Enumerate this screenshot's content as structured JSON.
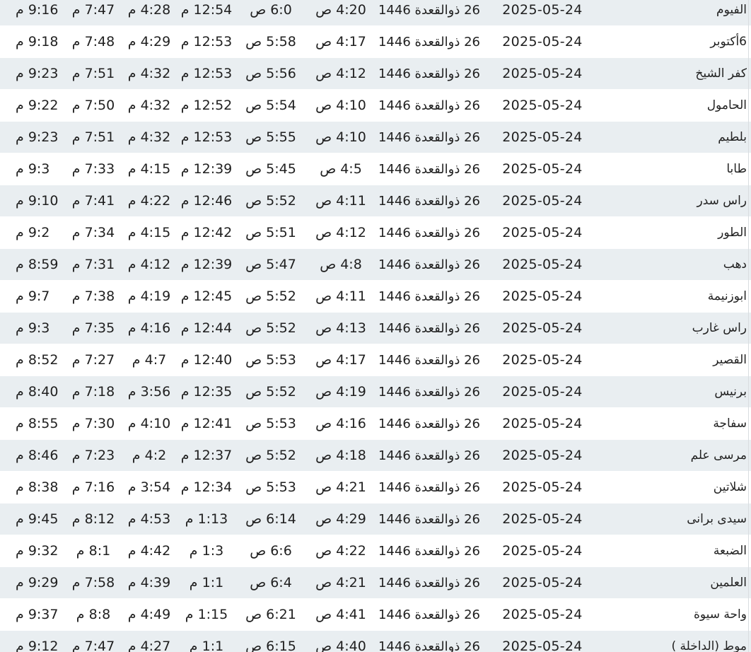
{
  "table": {
    "rows": [
      {
        "city": "الفيوم",
        "gregorian": "2025-05-24",
        "hijri": "26 ذوالقعدة 1446",
        "fajr": "4:20 ص",
        "sunrise": "6:0 ص",
        "dhuhr": "12:54 م",
        "asr": "4:28 م",
        "maghrib": "7:47 م",
        "isha": "9:16 م"
      },
      {
        "city": "6أكتوبر",
        "gregorian": "2025-05-24",
        "hijri": "26 ذوالقعدة 1446",
        "fajr": "4:17 ص",
        "sunrise": "5:58 ص",
        "dhuhr": "12:53 م",
        "asr": "4:29 م",
        "maghrib": "7:48 م",
        "isha": "9:18 م"
      },
      {
        "city": "كفر الشيخ",
        "gregorian": "2025-05-24",
        "hijri": "26 ذوالقعدة 1446",
        "fajr": "4:12 ص",
        "sunrise": "5:56 ص",
        "dhuhr": "12:53 م",
        "asr": "4:32 م",
        "maghrib": "7:51 م",
        "isha": "9:23 م"
      },
      {
        "city": "الحامول",
        "gregorian": "2025-05-24",
        "hijri": "26 ذوالقعدة 1446",
        "fajr": "4:10 ص",
        "sunrise": "5:54 ص",
        "dhuhr": "12:52 م",
        "asr": "4:32 م",
        "maghrib": "7:50 م",
        "isha": "9:22 م"
      },
      {
        "city": "بلطيم",
        "gregorian": "2025-05-24",
        "hijri": "26 ذوالقعدة 1446",
        "fajr": "4:10 ص",
        "sunrise": "5:55 ص",
        "dhuhr": "12:53 م",
        "asr": "4:32 م",
        "maghrib": "7:51 م",
        "isha": "9:23 م"
      },
      {
        "city": "طابا",
        "gregorian": "2025-05-24",
        "hijri": "26 ذوالقعدة 1446",
        "fajr": "4:5 ص",
        "sunrise": "5:45 ص",
        "dhuhr": "12:39 م",
        "asr": "4:15 م",
        "maghrib": "7:33 م",
        "isha": "9:3 م"
      },
      {
        "city": "راس سدر",
        "gregorian": "2025-05-24",
        "hijri": "26 ذوالقعدة 1446",
        "fajr": "4:11 ص",
        "sunrise": "5:52 ص",
        "dhuhr": "12:46 م",
        "asr": "4:22 م",
        "maghrib": "7:41 م",
        "isha": "9:10 م"
      },
      {
        "city": "الطور",
        "gregorian": "2025-05-24",
        "hijri": "26 ذوالقعدة 1446",
        "fajr": "4:12 ص",
        "sunrise": "5:51 ص",
        "dhuhr": "12:42 م",
        "asr": "4:15 م",
        "maghrib": "7:34 م",
        "isha": "9:2 م"
      },
      {
        "city": "دهب",
        "gregorian": "2025-05-24",
        "hijri": "26 ذوالقعدة 1446",
        "fajr": "4:8 ص",
        "sunrise": "5:47 ص",
        "dhuhr": "12:39 م",
        "asr": "4:12 م",
        "maghrib": "7:31 م",
        "isha": "8:59 م"
      },
      {
        "city": "ابوزنيمة",
        "gregorian": "2025-05-24",
        "hijri": "26 ذوالقعدة 1446",
        "fajr": "4:11 ص",
        "sunrise": "5:52 ص",
        "dhuhr": "12:45 م",
        "asr": "4:19 م",
        "maghrib": "7:38 م",
        "isha": "9:7 م"
      },
      {
        "city": "راس غارب",
        "gregorian": "2025-05-24",
        "hijri": "26 ذوالقعدة 1446",
        "fajr": "4:13 ص",
        "sunrise": "5:52 ص",
        "dhuhr": "12:44 م",
        "asr": "4:16 م",
        "maghrib": "7:35 م",
        "isha": "9:3 م"
      },
      {
        "city": "القصير",
        "gregorian": "2025-05-24",
        "hijri": "26 ذوالقعدة 1446",
        "fajr": "4:17 ص",
        "sunrise": "5:53 ص",
        "dhuhr": "12:40 م",
        "asr": "4:7 م",
        "maghrib": "7:27 م",
        "isha": "8:52 م"
      },
      {
        "city": "برنيس",
        "gregorian": "2025-05-24",
        "hijri": "26 ذوالقعدة 1446",
        "fajr": "4:19 ص",
        "sunrise": "5:52 ص",
        "dhuhr": "12:35 م",
        "asr": "3:56 م",
        "maghrib": "7:18 م",
        "isha": "8:40 م"
      },
      {
        "city": "سفاجة",
        "gregorian": "2025-05-24",
        "hijri": "26 ذوالقعدة 1446",
        "fajr": "4:16 ص",
        "sunrise": "5:53 ص",
        "dhuhr": "12:41 م",
        "asr": "4:10 م",
        "maghrib": "7:30 م",
        "isha": "8:55 م"
      },
      {
        "city": "مرسى علم",
        "gregorian": "2025-05-24",
        "hijri": "26 ذوالقعدة 1446",
        "fajr": "4:18 ص",
        "sunrise": "5:52 ص",
        "dhuhr": "12:37 م",
        "asr": "4:2 م",
        "maghrib": "7:23 م",
        "isha": "8:46 م"
      },
      {
        "city": "شلاتين",
        "gregorian": "2025-05-24",
        "hijri": "26 ذوالقعدة 1446",
        "fajr": "4:21 ص",
        "sunrise": "5:53 ص",
        "dhuhr": "12:34 م",
        "asr": "3:54 م",
        "maghrib": "7:16 م",
        "isha": "8:38 م"
      },
      {
        "city": "سيدى برانى",
        "gregorian": "2025-05-24",
        "hijri": "26 ذوالقعدة 1446",
        "fajr": "4:29 ص",
        "sunrise": "6:14 ص",
        "dhuhr": "1:13 م",
        "asr": "4:53 م",
        "maghrib": "8:12 م",
        "isha": "9:45 م"
      },
      {
        "city": "الضبعة",
        "gregorian": "2025-05-24",
        "hijri": "26 ذوالقعدة 1446",
        "fajr": "4:22 ص",
        "sunrise": "6:6 ص",
        "dhuhr": "1:3 م",
        "asr": "4:42 م",
        "maghrib": "8:1 م",
        "isha": "9:32 م"
      },
      {
        "city": "العلمين",
        "gregorian": "2025-05-24",
        "hijri": "26 ذوالقعدة 1446",
        "fajr": "4:21 ص",
        "sunrise": "6:4 ص",
        "dhuhr": "1:1 م",
        "asr": "4:39 م",
        "maghrib": "7:58 م",
        "isha": "9:29 م"
      },
      {
        "city": "واحة سيوة",
        "gregorian": "2025-05-24",
        "hijri": "26 ذوالقعدة 1446",
        "fajr": "4:41 ص",
        "sunrise": "6:21 ص",
        "dhuhr": "1:15 م",
        "asr": "4:49 م",
        "maghrib": "8:8 م",
        "isha": "9:37 م"
      },
      {
        "city": "موط (الداخلة )",
        "gregorian": "2025-05-24",
        "hijri": "26 ذوالقعدة 1446",
        "fajr": "4:40 ص",
        "sunrise": "6:15 ص",
        "dhuhr": "1:1 م",
        "asr": "4:27 م",
        "maghrib": "7:47 م",
        "isha": "9:12 م"
      }
    ]
  }
}
